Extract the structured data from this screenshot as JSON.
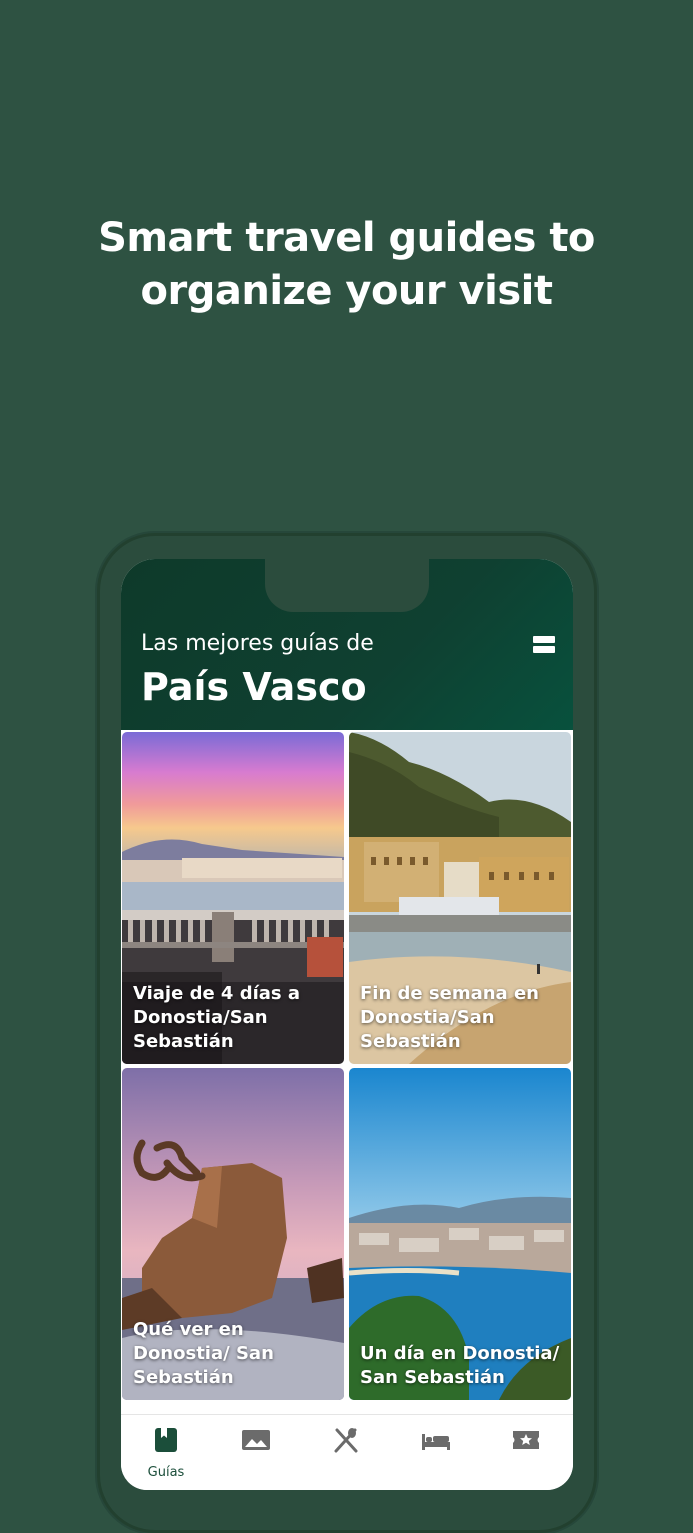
{
  "promo": {
    "headline_line1": "Smart travel guides to",
    "headline_line2": "organize your visit"
  },
  "app": {
    "header_subtitle": "Las mejores guías de",
    "header_title": "País Vasco",
    "guides": [
      {
        "title": "Viaje de 4 días a Donostia/San Sebastián"
      },
      {
        "title": "Fin de semana en Donostia/San Sebastián"
      },
      {
        "title": "Qué ver en Donostia/ San Sebastián"
      },
      {
        "title": "Un día en Donostia/ San Sebastián"
      }
    ],
    "tabs": [
      {
        "icon": "bookmark-icon",
        "label": "Guías",
        "active": true
      },
      {
        "icon": "image-icon",
        "label": ""
      },
      {
        "icon": "cutlery-icon",
        "label": ""
      },
      {
        "icon": "bed-icon",
        "label": ""
      },
      {
        "icon": "ticket-star-icon",
        "label": ""
      }
    ]
  },
  "colors": {
    "background": "#2e5242",
    "header": "#0f4031",
    "accent": "#1b4e3a"
  }
}
